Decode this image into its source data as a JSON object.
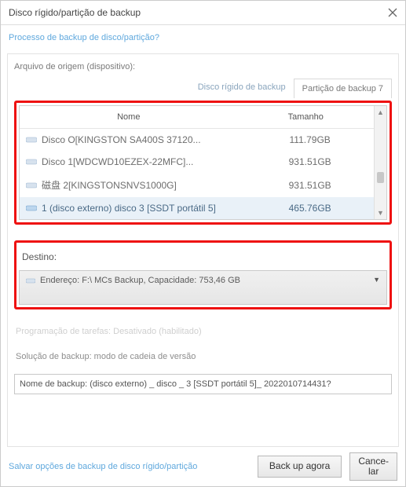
{
  "window": {
    "title": "Disco rígido/partição de backup",
    "breadcrumb": "Processo de backup de disco/partição?"
  },
  "source": {
    "label": "Arquivo de origem (dispositivo):",
    "tabs": {
      "disk": "Disco rígido de backup",
      "partition": "Partição de backup 7"
    },
    "columns": {
      "name": "Nome",
      "size": "Tamanho"
    },
    "rows": [
      {
        "name": "Disco O[KINGSTON SA400S 37120...",
        "size": "111.79GB",
        "selected": false
      },
      {
        "name": "Disco 1[WDCWD10EZEX-22MFC]...",
        "size": "931.51GB",
        "selected": false
      },
      {
        "name": "磁盘 2[KINGSTONSNVS1000G]",
        "size": "931.51GB",
        "selected": false
      },
      {
        "name": "1 (disco externo) disco 3 [SSDT portátil 5]",
        "size": "465.76GB",
        "selected": true
      }
    ]
  },
  "destination": {
    "label": "Destino:",
    "value": "Endereço: F:\\ MCs Backup, Capacidade: 753,46 GB"
  },
  "schedule": {
    "text": "Programação de tarefas: Desativado (habilitado)"
  },
  "solution": {
    "text": "Solução de backup: modo de cadeia de versão"
  },
  "backup_name": {
    "label_prefix": "Nome de backup:",
    "value": "(disco externo) _ disco _ 3 [SSDT portátil 5]_ 2022010714431?"
  },
  "footer": {
    "link": "Salvar opções de backup de disco rígido/partição",
    "backup_now": "Back up agora",
    "cancel": "Cance-\nlar"
  },
  "colors": {
    "highlight_box": "#ee1111",
    "link": "#5fa8dd"
  }
}
